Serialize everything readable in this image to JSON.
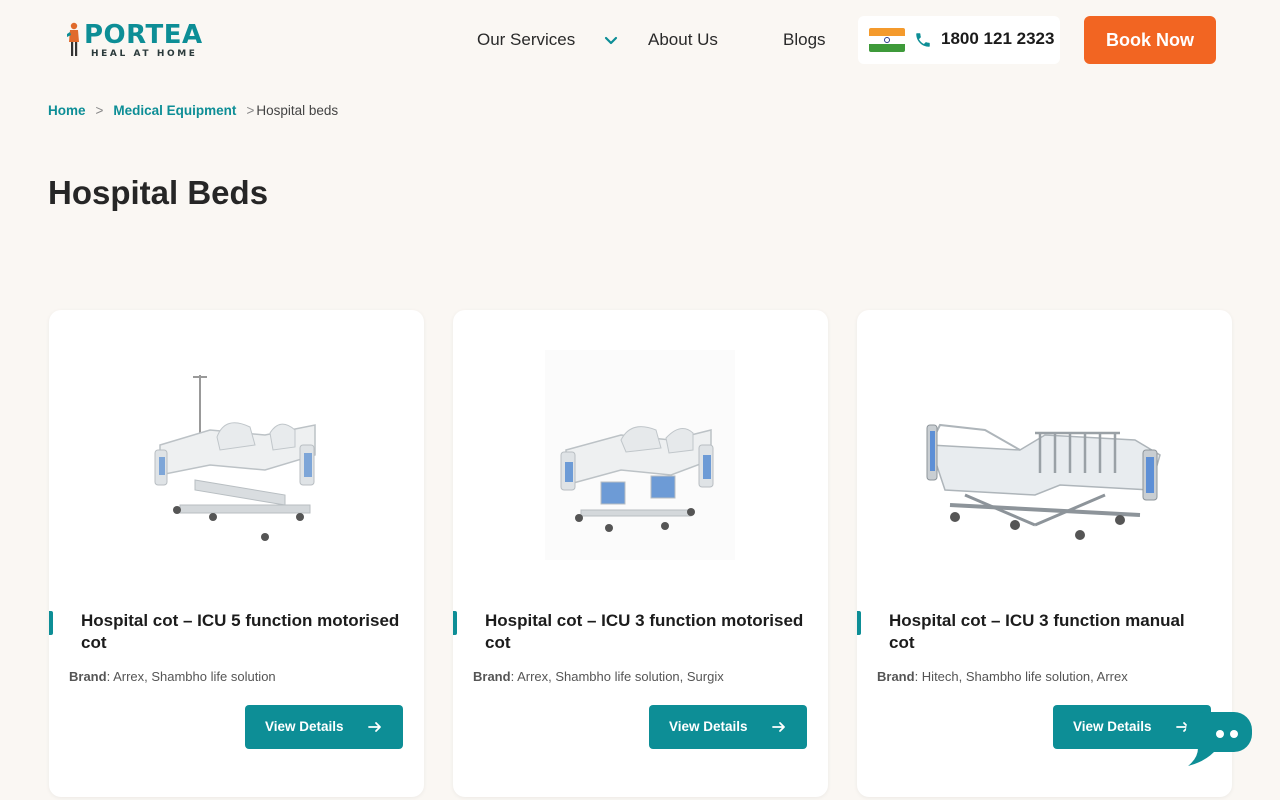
{
  "header": {
    "logo_text": "PORTEA",
    "logo_tagline": "HEAL AT HOME",
    "nav": {
      "services": "Our Services",
      "about": "About Us",
      "blogs": "Blogs"
    },
    "phone": "1800 121 2323",
    "book_button": "Book Now"
  },
  "breadcrumb": {
    "home": "Home",
    "sep1": ">",
    "medical_equipment": "Medical Equipment",
    "sep2": ">",
    "current": "Hospital beds"
  },
  "page_title": "Hospital Beds",
  "products": [
    {
      "title": "Hospital cot – ICU 5 function motorised cot",
      "brand_label": "Brand",
      "brand_value": ": Arrex, Shambho life solution",
      "button": "View Details"
    },
    {
      "title": "Hospital cot – ICU 3 function motorised cot",
      "brand_label": "Brand",
      "brand_value": ": Arrex, Shambho life solution, Surgix",
      "button": "View Details"
    },
    {
      "title": "Hospital cot – ICU 3 function manual cot",
      "brand_label": "Brand",
      "brand_value": ": Hitech, Shambho life solution, Arrex",
      "button": "View Details"
    }
  ],
  "colors": {
    "brand_teal": "#0d8e96",
    "accent_orange": "#f26522",
    "background": "#faf7f3"
  },
  "icons": {
    "chevron": "chevron-down-icon",
    "phone": "phone-icon",
    "arrow": "arrow-right-icon",
    "chat": "chat-icon",
    "flag": "india-flag-icon"
  }
}
